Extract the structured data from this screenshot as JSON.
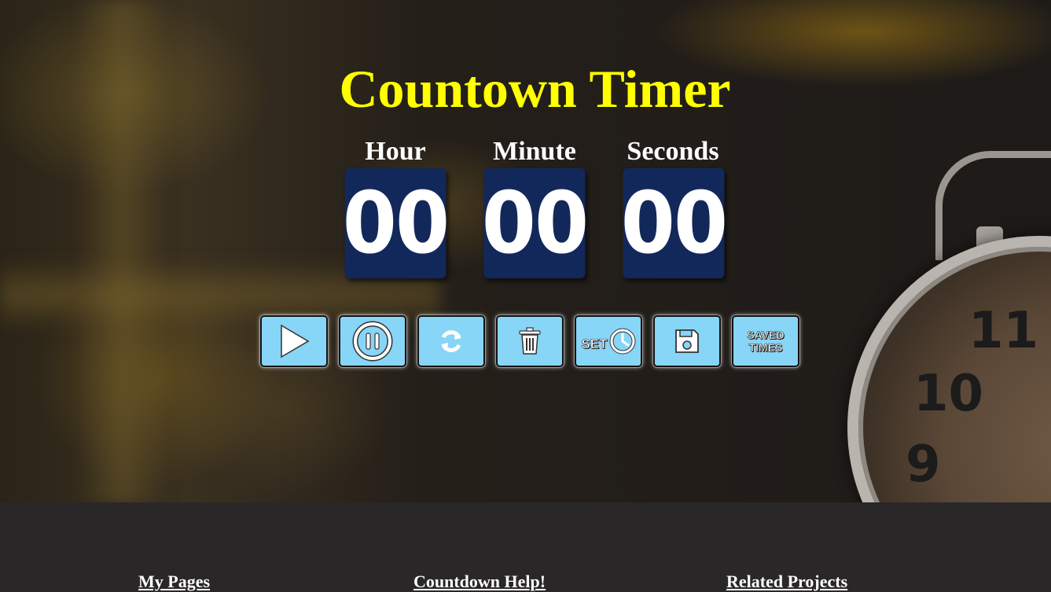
{
  "page": {
    "title": "Countown Timer"
  },
  "timer": {
    "units": [
      {
        "label": "Hour",
        "value": "00"
      },
      {
        "label": "Minute",
        "value": "00"
      },
      {
        "label": "Seconds",
        "value": "00"
      }
    ]
  },
  "controls": {
    "play_icon": "play-icon",
    "pause_icon": "pause-icon",
    "reset_icon": "refresh-icon",
    "delete_icon": "trash-icon",
    "set_label": "SET",
    "set_icon": "clock-icon",
    "save_icon": "floppy-disk-icon",
    "saved_label_line1": "SAVED",
    "saved_label_line2": "TIMES"
  },
  "footer": {
    "links": [
      "My Pages",
      "Countdown Help!",
      "Related Projects"
    ]
  },
  "background_clock": {
    "numbers": [
      "11",
      "10",
      "9"
    ]
  },
  "colors": {
    "title": "#ffff00",
    "digit_box": "#13285a",
    "button_bg": "#87d5f7",
    "footer_bg": "#2a2729"
  }
}
